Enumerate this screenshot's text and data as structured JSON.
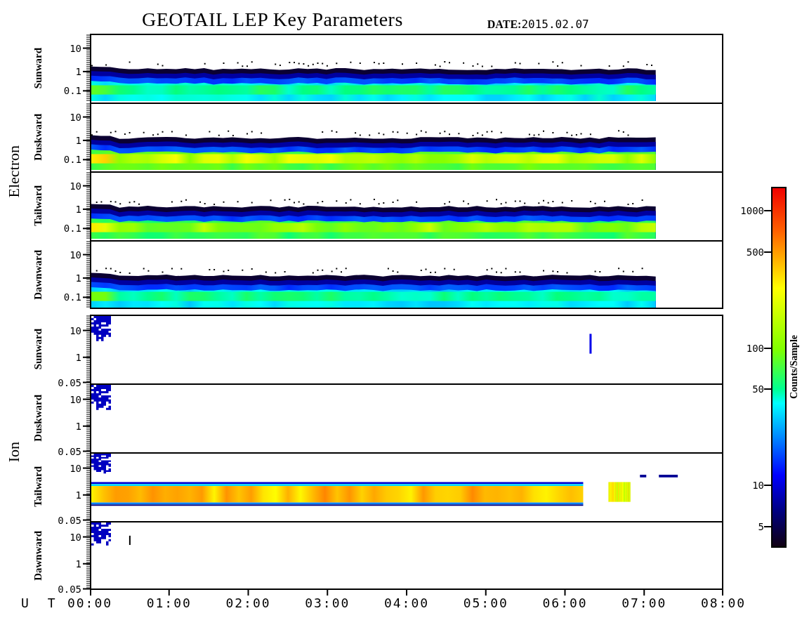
{
  "title": "GEOTAIL LEP Key Parameters",
  "date_label": "DATE:",
  "date": "2015.02.07",
  "groups": [
    {
      "name": "Electron",
      "panels": [
        {
          "direction": "Sunward",
          "kind": "band",
          "yticks": [
            "10",
            "1",
            "0.1"
          ]
        },
        {
          "direction": "Duskward",
          "kind": "band",
          "yticks": [
            "10",
            "1",
            "0.1"
          ]
        },
        {
          "direction": "Tailward",
          "kind": "band",
          "yticks": [
            "10",
            "1",
            "0.1"
          ]
        },
        {
          "direction": "Dawnward",
          "kind": "band",
          "yticks": [
            "10",
            "1",
            "0.1"
          ]
        }
      ]
    },
    {
      "name": "Ion",
      "panels": [
        {
          "direction": "Sunward",
          "kind": "burst",
          "yticks": [
            "10",
            "1",
            "0.05"
          ]
        },
        {
          "direction": "Duskward",
          "kind": "burst",
          "yticks": [
            "10",
            "1",
            "0.05"
          ]
        },
        {
          "direction": "Tailward",
          "kind": "burst-band",
          "yticks": [
            "10",
            "1",
            "0.05"
          ]
        },
        {
          "direction": "Dawnward",
          "kind": "burst",
          "yticks": [
            "10",
            "1",
            "0.05"
          ]
        }
      ]
    }
  ],
  "time_axis": {
    "label": "U T",
    "ticks": [
      "00:00",
      "01:00",
      "02:00",
      "03:00",
      "04:00",
      "05:00",
      "06:00",
      "07:00",
      "08:00"
    ]
  },
  "colorbar": {
    "title": "Counts/Sample",
    "ticks": [
      "1000",
      "500",
      "100",
      "50",
      "10",
      "5"
    ]
  }
}
